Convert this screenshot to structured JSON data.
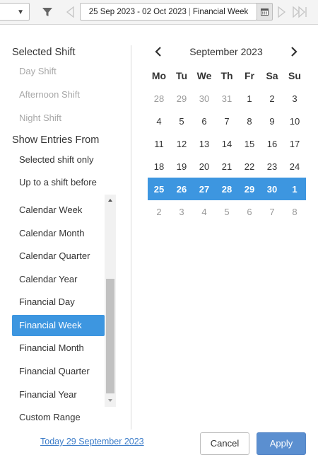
{
  "toolbar": {
    "dropdown_caret": "▼",
    "range_dates": "25 Sep 2023 - 02 Oct 2023",
    "range_separator": "|",
    "range_period": "Financial Week",
    "icons": [
      "filter-icon",
      "previous-arrow-icon",
      "calendar-icon",
      "next-arrow-icon",
      "last-arrow-icon"
    ]
  },
  "selected_shift": {
    "title": "Selected Shift",
    "options": [
      "Day Shift",
      "Afternoon Shift",
      "Night Shift"
    ]
  },
  "show_entries": {
    "title": "Show Entries From",
    "options": [
      "Selected shift only",
      "Up to a shift before"
    ]
  },
  "period_list": {
    "items": [
      "Calendar Week",
      "Calendar Month",
      "Calendar Quarter",
      "Calendar Year",
      "Financial Day",
      "Financial Week",
      "Financial Month",
      "Financial Quarter",
      "Financial Year",
      "Custom Range"
    ],
    "selected": "Financial Week"
  },
  "calendar": {
    "month_title": "September 2023",
    "weekdays": [
      "Mo",
      "Tu",
      "We",
      "Th",
      "Fr",
      "Sa",
      "Su"
    ],
    "weeks": [
      [
        "28",
        "29",
        "30",
        "31",
        "1",
        "2",
        "3"
      ],
      [
        "4",
        "5",
        "6",
        "7",
        "8",
        "9",
        "10"
      ],
      [
        "11",
        "12",
        "13",
        "14",
        "15",
        "16",
        "17"
      ],
      [
        "18",
        "19",
        "20",
        "21",
        "22",
        "23",
        "24"
      ],
      [
        "25",
        "26",
        "27",
        "28",
        "29",
        "30",
        "1"
      ],
      [
        "2",
        "3",
        "4",
        "5",
        "6",
        "7",
        "8"
      ]
    ],
    "selected_week_index": 4,
    "accent_color": "#3d96e0"
  },
  "footer": {
    "today_link": "Today 29 September 2023",
    "cancel_label": "Cancel",
    "apply_label": "Apply"
  }
}
